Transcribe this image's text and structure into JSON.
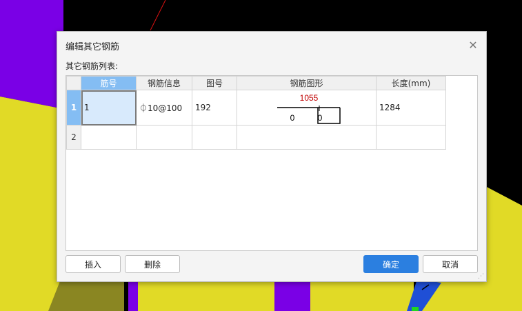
{
  "dialog": {
    "title": "编辑其它钢筋",
    "list_label": "其它钢筋列表:",
    "close_icon": "close-icon"
  },
  "grid": {
    "columns": [
      "筋号",
      "钢筋信息",
      "图号",
      "钢筋图形",
      "长度(mm)"
    ],
    "rows": [
      {
        "row_number": "1",
        "bar_number": "1",
        "rebar_info": "⏀10@100",
        "figure_number": "192",
        "shape": {
          "dimension": "1055",
          "left_value": "0",
          "right_value": "0"
        },
        "length": "1284"
      },
      {
        "row_number": "2",
        "bar_number": "",
        "rebar_info": "",
        "figure_number": "",
        "shape": {
          "dimension": "",
          "left_value": "",
          "right_value": ""
        },
        "length": ""
      }
    ]
  },
  "buttons": {
    "insert": "插入",
    "delete": "删除",
    "ok": "确定",
    "cancel": "取消"
  },
  "colors": {
    "accent": "#2b7fe0",
    "header_active": "#84bdf3",
    "dimension_text": "#c00000"
  }
}
